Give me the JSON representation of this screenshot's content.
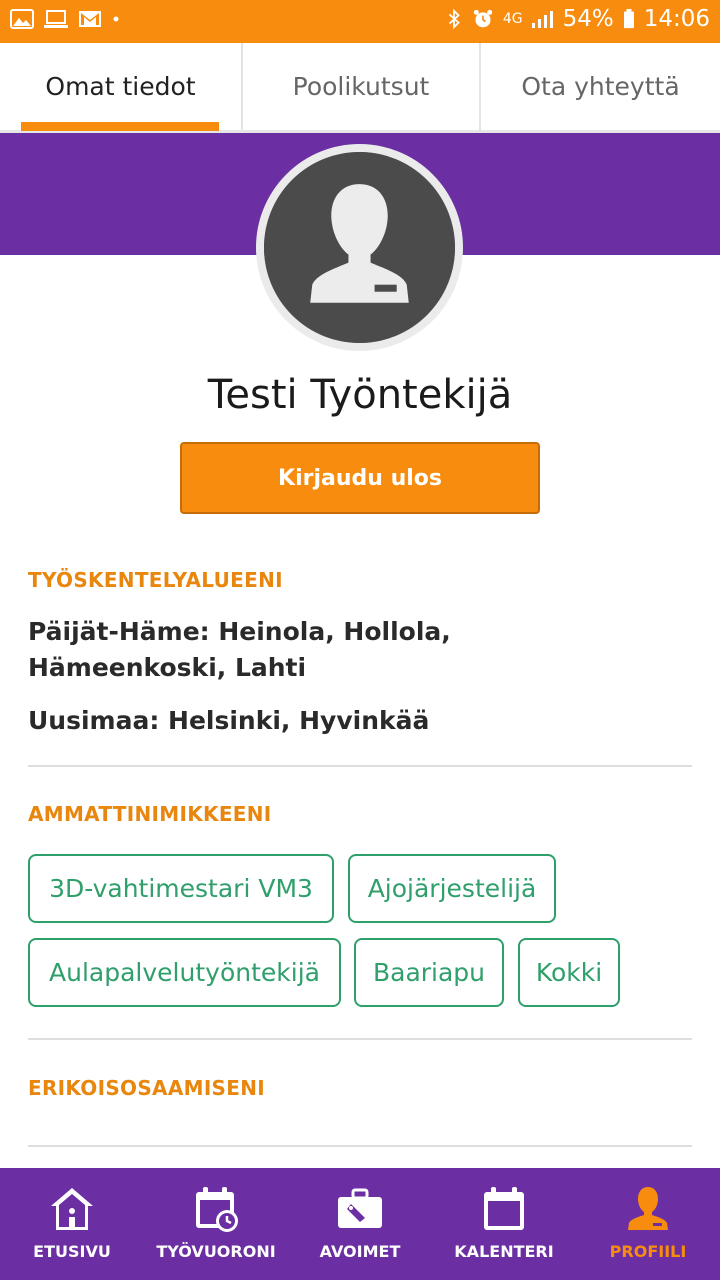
{
  "status_bar": {
    "battery": "54%",
    "time": "14:06",
    "network": "4G",
    "icons_left": [
      "gallery-icon",
      "laptop-icon",
      "gmail-icon",
      "dot-icon"
    ],
    "icons_right": [
      "bluetooth-icon",
      "alarm-icon",
      "signal-icon",
      "battery-icon"
    ]
  },
  "tabs": [
    {
      "label": "Omat tiedot",
      "active": true
    },
    {
      "label": "Poolikutsut",
      "active": false
    },
    {
      "label": "Ota yhteyttä",
      "active": false
    }
  ],
  "profile": {
    "name": "Testi Työntekijä",
    "logout_label": "Kirjaudu ulos"
  },
  "work_areas": {
    "title": "TYÖSKENTELYALUEENI",
    "lines": [
      "Päijät-Häme: Heinola, Hollola,",
      "Hämeenkoski, Lahti",
      "Uusimaa: Helsinki, Hyvinkää"
    ]
  },
  "job_titles": {
    "title": "AMMATTINIMIKKEENI",
    "chips": [
      "3D-vahtimestari VM3",
      "Ajojärjestelijä",
      "Aulapalvelutyöntekijä",
      "Baariapu",
      "Kokki"
    ]
  },
  "special_skills": {
    "title": "ERIKOISOSAAMISENI"
  },
  "bottom_nav": [
    {
      "label": "ETUSIVU",
      "icon": "home-icon",
      "active": false
    },
    {
      "label": "TYÖVUORONI",
      "icon": "calendar-clock-icon",
      "active": false
    },
    {
      "label": "AVOIMET",
      "icon": "briefcase-icon",
      "active": false
    },
    {
      "label": "KALENTERI",
      "icon": "calendar-icon",
      "active": false
    },
    {
      "label": "PROFIILI",
      "icon": "person-icon",
      "active": true
    }
  ],
  "colors": {
    "accent_orange": "#f78c0f",
    "brand_purple": "#6b2fa3",
    "chip_green": "#2f9f6b"
  }
}
